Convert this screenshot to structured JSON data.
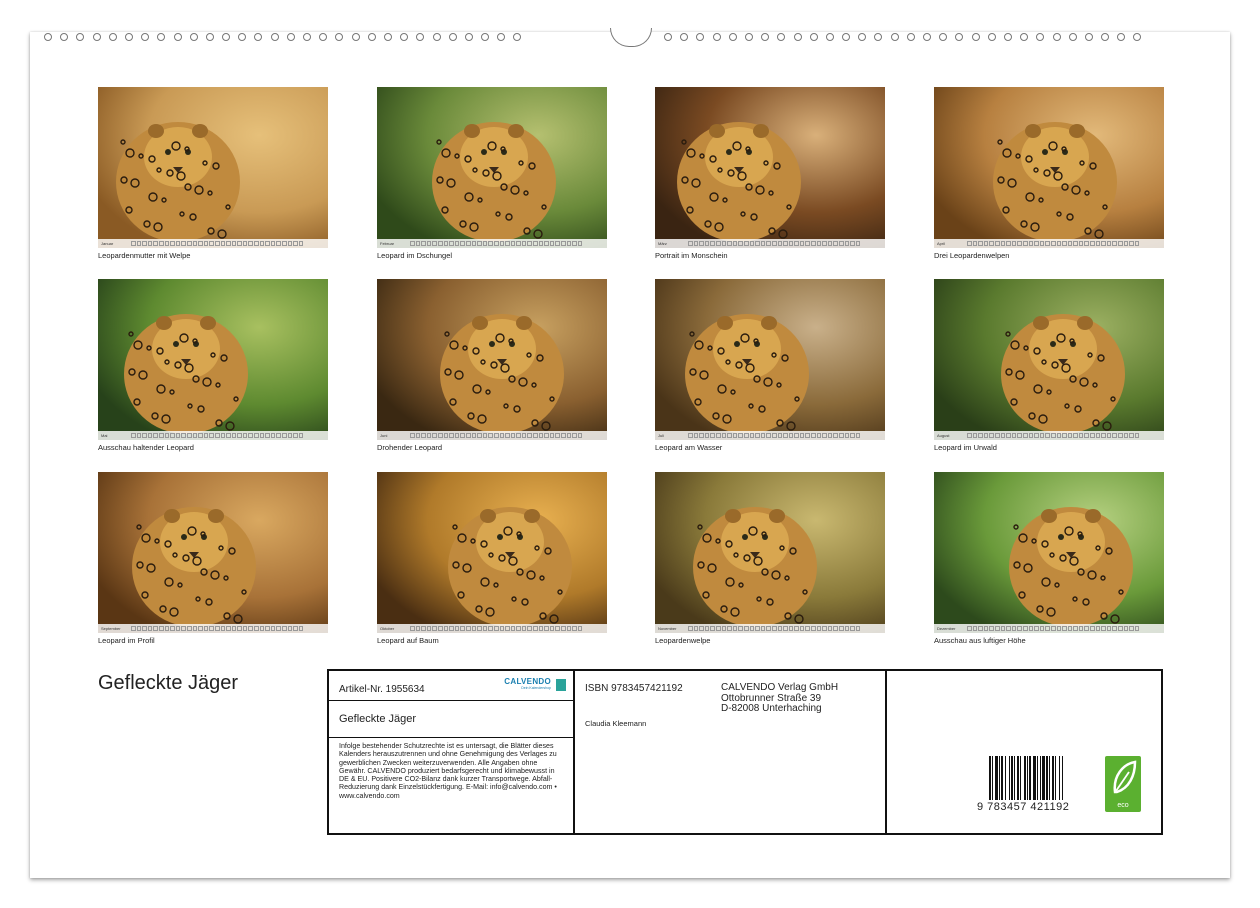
{
  "calendar": {
    "title": "Gefleckte Jäger",
    "months": [
      {
        "month": "Januar",
        "caption": "Leopardenmutter mit Welpe"
      },
      {
        "month": "Februar",
        "caption": "Leopard im Dschungel"
      },
      {
        "month": "März",
        "caption": "Portrait im Monschein"
      },
      {
        "month": "April",
        "caption": "Drei Leopardenwelpen"
      },
      {
        "month": "Mai",
        "caption": "Ausschau haltender Leopard"
      },
      {
        "month": "Juni",
        "caption": "Drohender Leopard"
      },
      {
        "month": "Juli",
        "caption": "Leopard am Wasser"
      },
      {
        "month": "August",
        "caption": "Leopard im Urwald"
      },
      {
        "month": "September",
        "caption": "Leopard im Profil"
      },
      {
        "month": "Oktober",
        "caption": "Leopard auf Baum"
      },
      {
        "month": "November",
        "caption": "Leopardenwelpe"
      },
      {
        "month": "Dezember",
        "caption": "Ausschau aus luftiger Höhe"
      }
    ]
  },
  "info": {
    "article": "Artikel-Nr. 1955634",
    "logo": "CALVENDO",
    "logo_sub": "Dein Kalendershop",
    "title": "Gefleckte Jäger",
    "legal": "Infolge bestehender Schutzrechte ist es untersagt, die Blätter dieses Kalenders herauszutrennen und ohne Genehmigung des Verlages zu gewerblichen Zwecken weiterzuverwenden. Alle Angaben ohne Gewähr. CALVENDO produziert bedarfsgerecht und klimabewusst in DE & EU. Positivere CO2-Bilanz dank kurzer Transportwege. Abfall-Reduzierung dank Einzelstückfertigung. E-Mail: info@calvendo.com • www.calvendo.com",
    "isbn": "ISBN 9783457421192",
    "author": "Claudia Kleemann",
    "publisher": [
      "CALVENDO Verlag GmbH",
      "Ottobrunner Straße 39",
      "D-82008 Unterhaching"
    ],
    "barcode_number": "9 783457 421192",
    "eco_label": "eco"
  },
  "colors": {
    "warm": "#b07a3a",
    "jungle": "#4f7a2a",
    "eco_green": "#5bb030",
    "brand_blue": "#1a7fb0"
  }
}
